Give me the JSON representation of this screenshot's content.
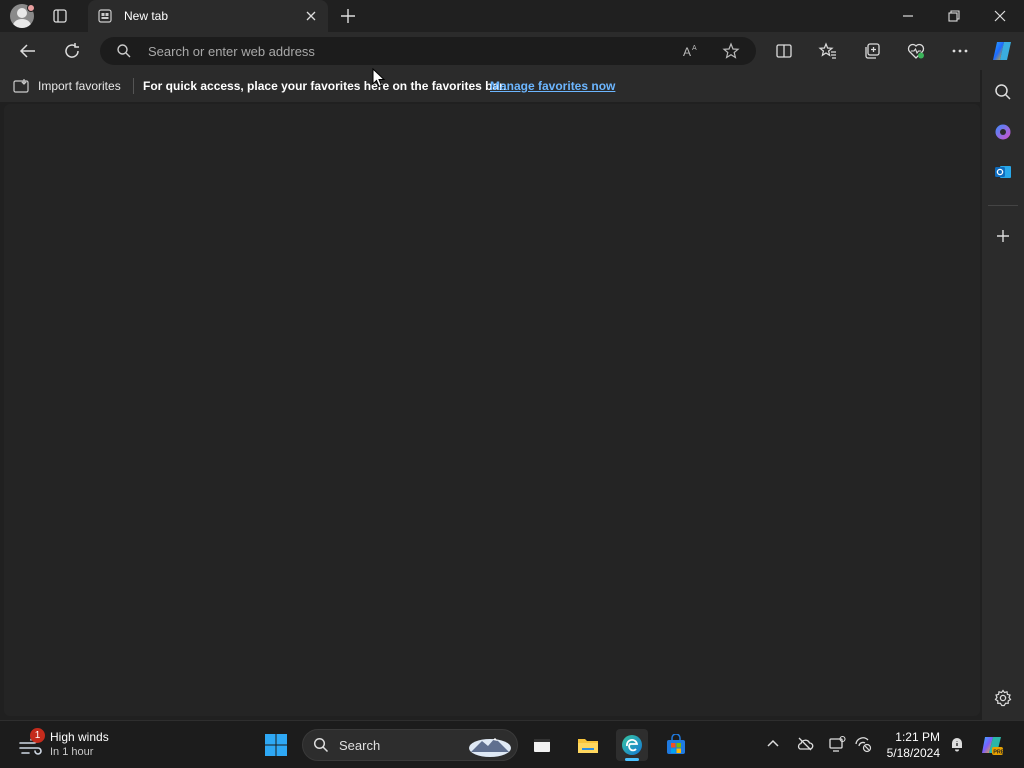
{
  "window": {
    "tab_title": "New tab",
    "icons": {
      "profile": "avatar",
      "workspaces": "tab-actions-icon",
      "close_tab": "close-icon",
      "new_tab": "plus-icon",
      "minimize": "minimize-icon",
      "restore": "restore-icon",
      "close": "close-icon"
    }
  },
  "toolbar": {
    "address_placeholder": "Search or enter web address",
    "icons": [
      "back-icon",
      "refresh-icon",
      "search-icon",
      "read-aloud-icon",
      "favorite-star-icon",
      "split-screen-icon",
      "favorites-icon",
      "collections-icon",
      "browser-essentials-icon",
      "more-icon",
      "copilot-icon"
    ]
  },
  "favorites_bar": {
    "import_label": "Import favorites",
    "message": "For quick access, place your favorites here on the favorites bar.",
    "link": "Manage favorites now",
    "link_color": "#6cb6ff"
  },
  "sidebar": {
    "icons": [
      "search-icon",
      "copilot-icon",
      "outlook-icon",
      "plus-icon",
      "settings-icon"
    ]
  },
  "taskbar": {
    "weather": {
      "title": "High winds",
      "subtitle": "In 1 hour",
      "badge": "1"
    },
    "search_label": "Search",
    "apps": [
      "start-icon",
      "task-view-icon",
      "file-explorer-icon",
      "edge-icon",
      "store-icon"
    ],
    "tray_icons": [
      "chevron-up-icon",
      "onedrive-offline-icon",
      "display-icon",
      "network-icon",
      "notification-icon",
      "copilot-icon"
    ],
    "clock": {
      "time": "1:21 PM",
      "date": "5/18/2024"
    }
  },
  "theme": {
    "background": "#202020",
    "toolbar": "#2b2b2b",
    "content": "#242424",
    "accent": "#4cc2ff"
  }
}
